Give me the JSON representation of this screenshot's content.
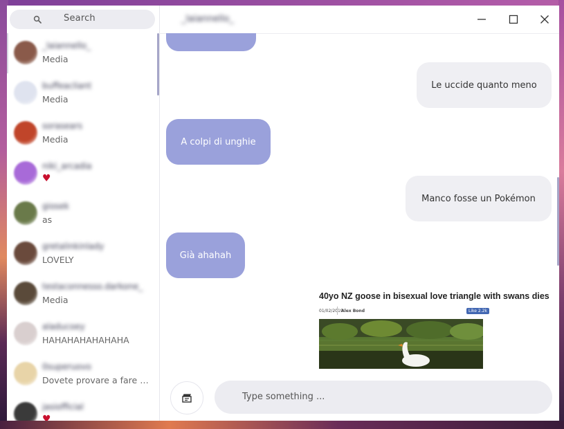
{
  "search": {
    "placeholder": "Search"
  },
  "header": {
    "title": "_laiannello_"
  },
  "window_controls": {
    "minimize": "—",
    "maximize": "☐",
    "close": "✕"
  },
  "chats": [
    {
      "name": "_laiannello_",
      "preview": "Media",
      "avatar_color": "#8a5a4a"
    },
    {
      "name": "buffeacliant",
      "preview": "Media",
      "avatar_color": "#dfe3ef"
    },
    {
      "name": "sorasears",
      "preview": "Media",
      "avatar_color": "#c0452a"
    },
    {
      "name": "niki_arcadia",
      "preview": "♥",
      "avatar_color": "#a86ad8"
    },
    {
      "name": "giosek",
      "preview": "as",
      "avatar_color": "#6a7a4a"
    },
    {
      "name": "gretalinkinlady",
      "preview": "LOVELY",
      "avatar_color": "#6a4a3c"
    },
    {
      "name": "testaconnesso.darkone_",
      "preview": "Media",
      "avatar_color": "#5a4a3a"
    },
    {
      "name": "aladucoey",
      "preview": "HAHAHAHAHAHAHA",
      "avatar_color": "#d9cfcf"
    },
    {
      "name": "0superuovo",
      "preview": "Dovete provare a fare una cosa",
      "avatar_color": "#e8d4a8"
    },
    {
      "name": "jasiofficial",
      "preview": "♥",
      "avatar_color": "#3a3a3a"
    }
  ],
  "messages": [
    {
      "text": "",
      "direction": "in"
    },
    {
      "text": "Le uccide quanto meno",
      "direction": "out"
    },
    {
      "text": "A colpi di unghie",
      "direction": "in"
    },
    {
      "text": "Manco fosse un Pokémon",
      "direction": "out"
    },
    {
      "text": "Già ahahah",
      "direction": "in"
    }
  ],
  "link_preview": {
    "title": "40yo NZ goose in bisexual love triangle with swans dies",
    "date": "01/02/2019",
    "author": "Alex Bond",
    "like": "Like 2.2k"
  },
  "composer": {
    "placeholder": "Type something ..."
  },
  "colors": {
    "incoming_bubble": "#9aa1db",
    "outgoing_bubble": "#efeff3",
    "accent": "#a6a6c8"
  }
}
